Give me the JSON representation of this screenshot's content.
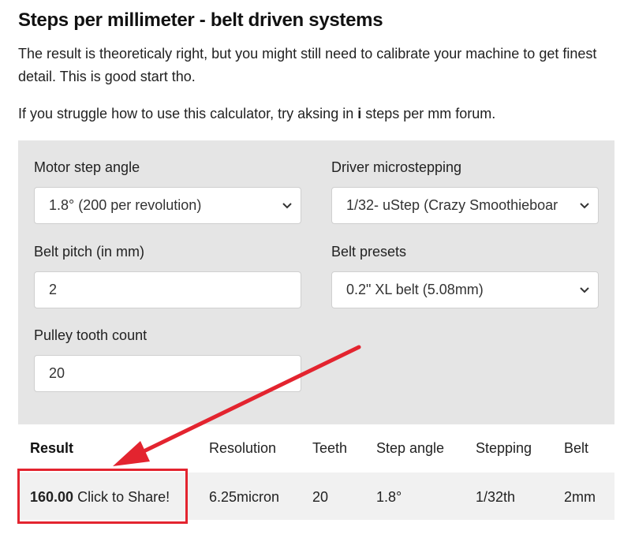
{
  "header": {
    "title": "Steps per millimeter - belt driven systems",
    "intro": "The result is theoreticaly right, but you might still need to calibrate your machine to get finest detail. This is good start tho.",
    "help_prefix": "If you struggle how to use this calculator, try aksing in ",
    "help_bold": "i",
    "help_suffix": " steps per mm forum."
  },
  "form": {
    "motor_step_angle": {
      "label": "Motor step angle",
      "value": "1.8° (200 per revolution)"
    },
    "driver_microstepping": {
      "label": "Driver microstepping",
      "value": "1/32- uStep (Crazy Smoothieboar"
    },
    "belt_pitch": {
      "label": "Belt pitch (in mm)",
      "value": "2"
    },
    "belt_presets": {
      "label": "Belt presets",
      "value": "0.2\" XL belt (5.08mm)"
    },
    "pulley_tooth_count": {
      "label": "Pulley tooth count",
      "value": "20"
    }
  },
  "results": {
    "headers": [
      "Result",
      "Resolution",
      "Teeth",
      "Step angle",
      "Stepping",
      "Belt"
    ],
    "row": {
      "result_value": "160.00",
      "share_text": " Click to Share!",
      "resolution": "6.25micron",
      "teeth": "20",
      "step_angle": "1.8°",
      "stepping": "1/32th",
      "belt": "2mm"
    }
  },
  "colors": {
    "annotation_red": "#e3242f",
    "panel_bg": "#e5e5e5"
  },
  "icons": [
    "chevron-down-icon"
  ]
}
